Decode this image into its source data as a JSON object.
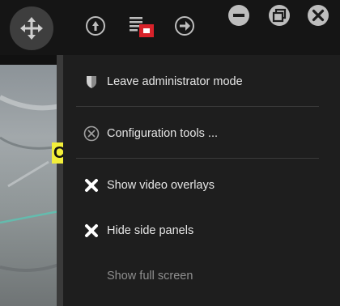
{
  "toolbar": {
    "icons": [
      "move-icon",
      "info-icon",
      "alarm-list-icon",
      "forward-icon",
      "minimize-icon",
      "restore-icon",
      "close-icon"
    ]
  },
  "video": {
    "overlay_label": "C"
  },
  "menu": {
    "items": [
      {
        "label": "Leave administrator mode",
        "icon": "shield-icon",
        "enabled": true
      },
      {
        "label": "Configuration tools ...",
        "icon": "tools-icon",
        "enabled": true
      },
      {
        "label": "Show video overlays",
        "icon": "x-check-icon",
        "enabled": true
      },
      {
        "label": "Hide side panels",
        "icon": "x-check-icon",
        "enabled": true
      },
      {
        "label": "Show full screen",
        "icon": "",
        "enabled": false
      }
    ]
  },
  "colors": {
    "accent_red": "#d8222a",
    "overlay_yellow": "#f2ee3a"
  }
}
